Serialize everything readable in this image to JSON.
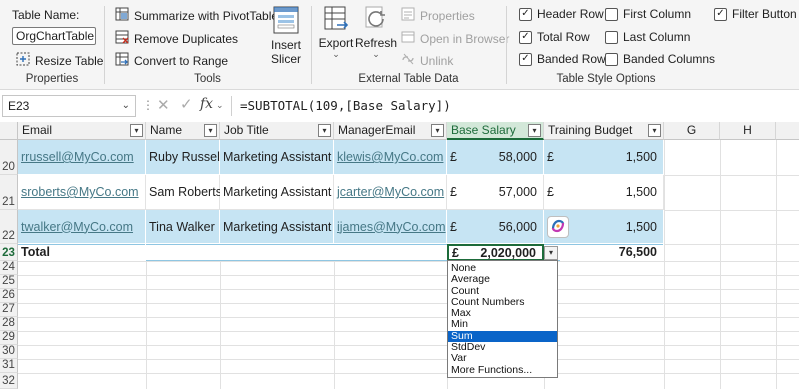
{
  "ribbon": {
    "properties": {
      "table_name_label": "Table Name:",
      "table_name_value": "OrgChartTable",
      "resize_label": "Resize Table",
      "group_label": "Properties"
    },
    "tools": {
      "summarize_label": "Summarize with PivotTable",
      "remove_dup_label": "Remove Duplicates",
      "convert_label": "Convert to Range",
      "insert_slicer_label": "Insert Slicer",
      "group_label": "Tools"
    },
    "external": {
      "export_label": "Export",
      "refresh_label": "Refresh",
      "properties_label": "Properties",
      "open_browser_label": "Open in Browser",
      "unlink_label": "Unlink",
      "group_label": "External Table Data"
    },
    "style_options": {
      "header_row": "Header Row",
      "total_row": "Total Row",
      "banded_rows": "Banded Rows",
      "first_column": "First Column",
      "last_column": "Last Column",
      "banded_columns": "Banded Columns",
      "filter_button": "Filter Button",
      "group_label": "Table Style Options",
      "checked": {
        "header_row": true,
        "total_row": true,
        "banded_rows": true,
        "first_column": false,
        "last_column": false,
        "banded_columns": false,
        "filter_button": true
      }
    }
  },
  "formula_bar": {
    "name_box": "E23",
    "fx": "fx",
    "formula": "=SUBTOTAL(109,[Base Salary])"
  },
  "grid": {
    "columns": [
      "Email",
      "Name",
      "Job Title",
      "ManagerEmail",
      "Base Salary",
      "Training Budget",
      "G",
      "H"
    ],
    "rows": [
      {
        "num": "20",
        "email": "rrussell@MyCo.com",
        "name": "Ruby Russell",
        "title": "Marketing Assistant",
        "manager": "klewis@MyCo.com",
        "currency": "£",
        "salary": "58,000",
        "budget_currency": "£",
        "budget": "1,500"
      },
      {
        "num": "21",
        "email": "sroberts@MyCo.com",
        "name": "Sam Roberts",
        "title": "Marketing Assistant",
        "manager": "jcarter@MyCo.com",
        "currency": "£",
        "salary": "57,000",
        "budget_currency": "£",
        "budget": "1,500"
      },
      {
        "num": "22",
        "email": "twalker@MyCo.com",
        "name": "Tina Walker",
        "title": "Marketing Assistant",
        "manager": "ijames@MyCo.com",
        "currency": "£",
        "salary": "56,000",
        "budget_currency": "",
        "budget": "1,500"
      }
    ],
    "total_row": {
      "num": "23",
      "label": "Total",
      "currency": "£",
      "salary": "2,020,000",
      "budget": "76,500"
    },
    "empty_rows": [
      "24",
      "25",
      "26",
      "27",
      "28",
      "29",
      "30",
      "31",
      "32"
    ]
  },
  "function_list": {
    "items": [
      "None",
      "Average",
      "Count",
      "Count Numbers",
      "Max",
      "Min",
      "Sum",
      "StdDev",
      "Var",
      "More Functions..."
    ],
    "selected": "Sum"
  },
  "colors": {
    "band": "#c6e4f3",
    "link": "#467886",
    "selection": "#0a64c8",
    "excel_green": "#1d6b3a"
  }
}
